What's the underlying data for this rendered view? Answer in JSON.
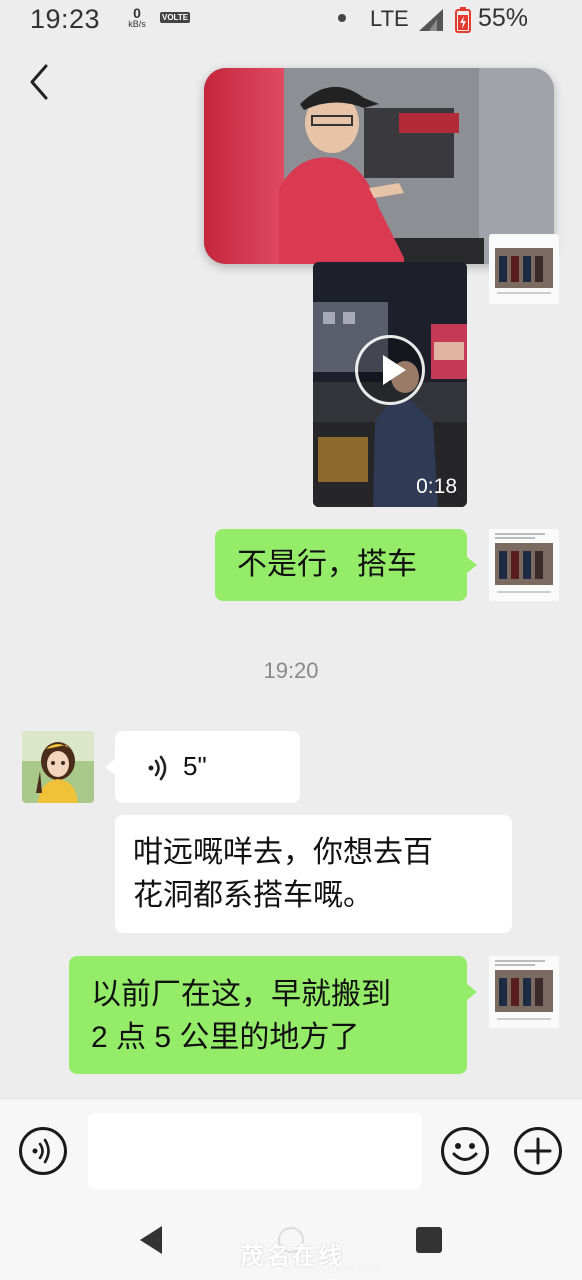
{
  "status_bar": {
    "time": "19:23",
    "net_speed_value": "0",
    "net_speed_unit": "kB/s",
    "volte": "VOLTE",
    "network": "LTE",
    "battery_percent": "55%"
  },
  "chat": {
    "messages": [
      {
        "type": "image",
        "side": "right"
      },
      {
        "type": "video",
        "side": "right",
        "duration": "0:18"
      },
      {
        "type": "text",
        "side": "right",
        "text": "不是行，搭车"
      },
      {
        "type": "timestamp",
        "text": "19:20"
      },
      {
        "type": "voice",
        "side": "left",
        "duration": "5\""
      },
      {
        "type": "text",
        "side": "left",
        "lines": [
          "咁远嘅咩去，你想去百",
          "花洞都系搭车嘅。"
        ]
      },
      {
        "type": "text",
        "side": "right",
        "lines": [
          "以前厂在这，早就搬到",
          "2 点 5 公里的地方了"
        ]
      }
    ]
  },
  "input_bar": {
    "voice_icon": "voice-mode-icon",
    "emoji_icon": "emoji-icon",
    "plus_icon": "plus-icon"
  },
  "watermark": {
    "text": "茂名在线",
    "url": "WWW.GDMM.COM"
  },
  "colors": {
    "background": "#ededed",
    "sent_bubble": "#95ec69",
    "received_bubble": "#ffffff"
  }
}
